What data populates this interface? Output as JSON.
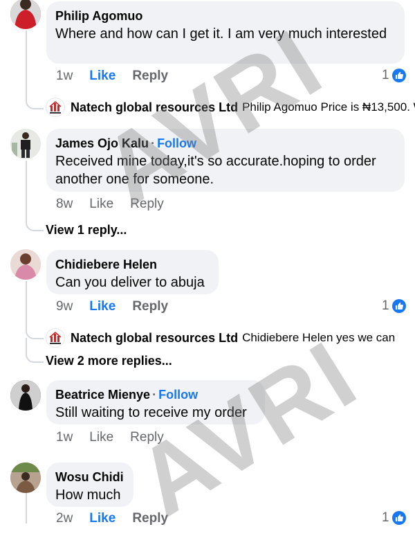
{
  "comments": [
    {
      "author": "Philip Agomuo",
      "text": "Where and how can I get it. I am very much interested",
      "time": "1w",
      "like": "Like",
      "reply": "Reply",
      "reactions": "1",
      "liked": true
    },
    {
      "author": "James Ojo Kalu",
      "follow": "Follow",
      "text": "Received mine today,it's so accurate.hoping to order another one for someone.",
      "time": "8w",
      "like": "Like",
      "reply": "Reply"
    },
    {
      "author": "Chidiebere Helen",
      "text": "Can you deliver to abuja",
      "time": "9w",
      "like": "Like",
      "reply": "Reply",
      "reactions": "1",
      "liked": true
    },
    {
      "author": "Beatrice Mienye",
      "follow": "Follow",
      "text": "Still waiting to receive my order",
      "time": "1w",
      "like": "Like",
      "reply": "Reply"
    },
    {
      "author": "Wosu Chidi",
      "text": "How much",
      "time": "2w",
      "like": "Like",
      "reply": "Reply",
      "reactions": "1",
      "liked": true
    }
  ],
  "replies": [
    {
      "author": "Natech global resources Ltd",
      "text": "Philip Agomuo Price is ₦13,500. W"
    },
    {
      "author": "Natech global resources Ltd",
      "text": "Chidiebere Helen yes we can"
    }
  ],
  "view_replies": [
    "View 1 reply...",
    "View 2 more replies..."
  ],
  "watermark": "AVRI",
  "colors": {
    "accent": "#1877f2",
    "bubble": "#f0f2f5",
    "muted": "#65676b"
  }
}
